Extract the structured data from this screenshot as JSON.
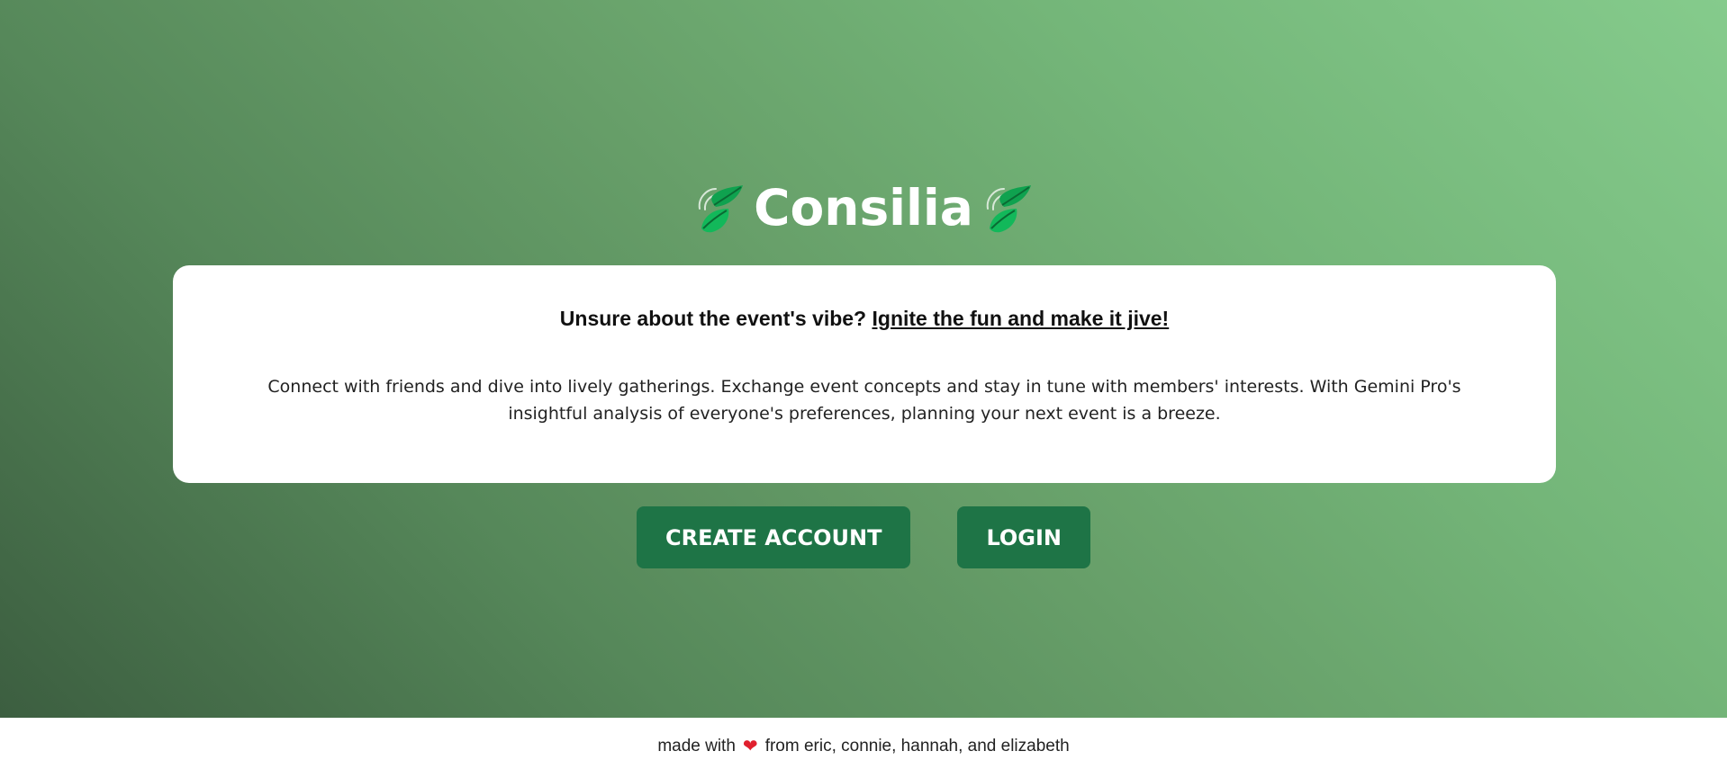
{
  "header": {
    "title": "Consilia",
    "left_icon": "leaf-icon",
    "right_icon": "leaf-icon"
  },
  "card": {
    "tagline_prefix": "Unsure about the event's vibe? ",
    "tagline_link": "Ignite the fun and make it jive!",
    "description": "Connect with friends and dive into lively gatherings. Exchange event concepts and stay in tune with members' interests. With Gemini Pro's insightful analysis of everyone's preferences, planning your next event is a breeze."
  },
  "actions": {
    "create_account_label": "CREATE ACCOUNT",
    "login_label": "LOGIN"
  },
  "footer": {
    "prefix": "made with",
    "heart_icon": "heart-icon",
    "heart_glyph": "❤",
    "suffix": "from eric, connie, hannah, and elizabeth"
  },
  "colors": {
    "button_bg": "#1e7446",
    "gradient_dark": "#3c5e40",
    "gradient_light": "#85cb8c",
    "heart": "#e0202e"
  }
}
